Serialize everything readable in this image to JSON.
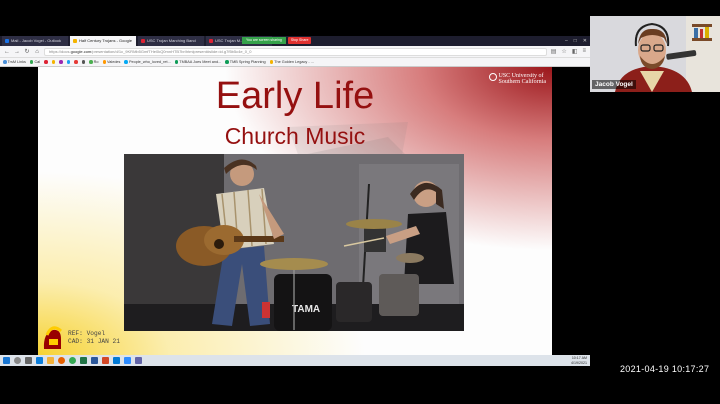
{
  "browser": {
    "tabs": [
      {
        "title": "Mail - Jacob Vogel - Outlook",
        "active": false
      },
      {
        "title": "Half Century Trojans - Google",
        "active": true
      },
      {
        "title": "USC Trojan Marching Band",
        "active": false
      },
      {
        "title": "USC Trojan M...",
        "active": false
      }
    ],
    "meeting_status": "You are screen sharing",
    "stop_share_label": "Stop Share",
    "url_prefix": "https://docs.",
    "url_domain": "google.com",
    "url_suffix": "/presentation/d/1c_9KRMb5GmfTHe0kQ0mnHTB7br/htmlpresent#slide=id.g7f5b5c4e_0_0",
    "bookmarks": [
      "TrsM Links",
      "Cal",
      "",
      "Ro",
      "Valedes",
      "People_who_loved_ret...",
      "TMBAA Joes Meet and...",
      "TMB Spring Planning",
      "The Golden Legacy - ..."
    ]
  },
  "slide": {
    "title": "Early Life",
    "subtitle": "Church Music",
    "logo_line1": "USC University of",
    "logo_line2": "Southern California",
    "ref_line1": "REF: Vogel",
    "ref_line2": "CAD: 31 JAN 21",
    "drum_brand": "TAMA"
  },
  "page_button": "1",
  "taskbar": {
    "time": "10:17 AM",
    "date": "4/19/2021"
  },
  "webcam": {
    "name": "Jacob Vogel"
  },
  "recording_timestamp": "2021-04-19 10:17:27",
  "colors": {
    "title_maroon": "#951010",
    "usc_cardinal": "#990000",
    "usc_gold": "#ffcc00"
  }
}
